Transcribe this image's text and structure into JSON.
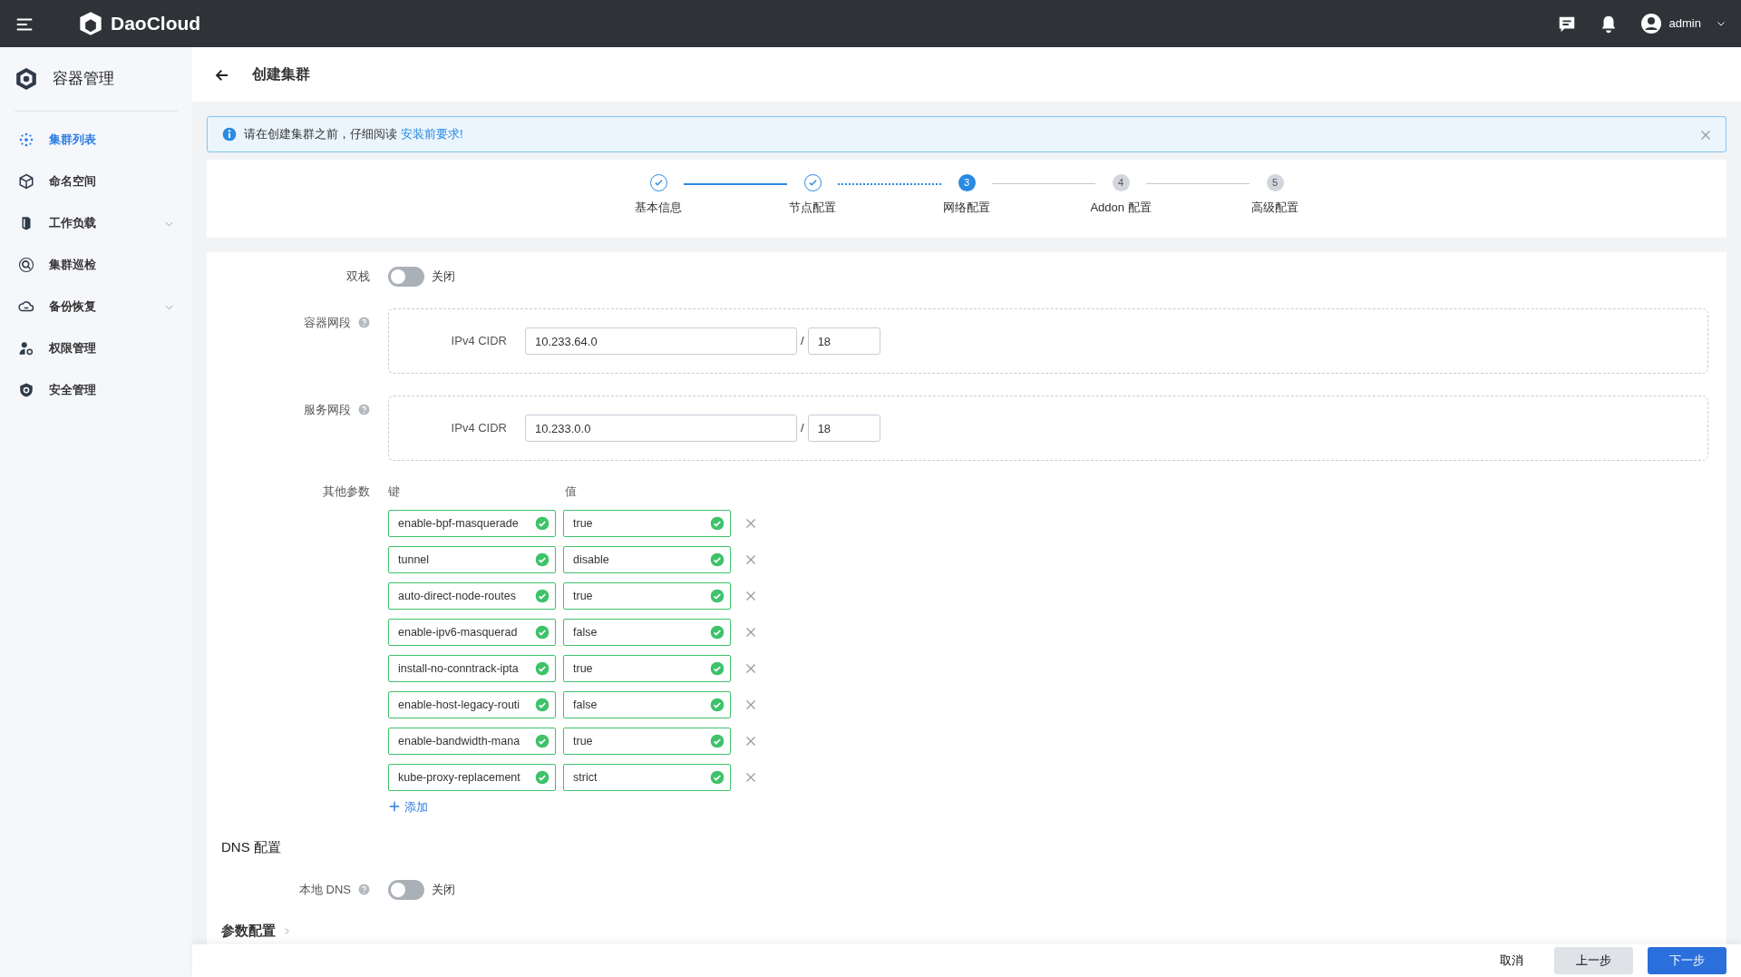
{
  "topbar": {
    "brand": "DaoCloud",
    "user": "admin"
  },
  "sidebar": {
    "title": "容器管理",
    "items": [
      {
        "label": "集群列表",
        "selected": true,
        "expandable": false
      },
      {
        "label": "命名空间",
        "selected": false,
        "expandable": false
      },
      {
        "label": "工作负载",
        "selected": false,
        "expandable": true
      },
      {
        "label": "集群巡检",
        "selected": false,
        "expandable": false
      },
      {
        "label": "备份恢复",
        "selected": false,
        "expandable": true
      },
      {
        "label": "权限管理",
        "selected": false,
        "expandable": false
      },
      {
        "label": "安全管理",
        "selected": false,
        "expandable": false
      }
    ]
  },
  "page": {
    "title": "创建集群"
  },
  "alert": {
    "text": "请在创建集群之前，仔细阅读",
    "link": "安装前要求!"
  },
  "steps": [
    {
      "label": "基本信息",
      "done": true,
      "selected": false
    },
    {
      "label": "节点配置",
      "done": true,
      "selected": false
    },
    {
      "label": "网络配置",
      "number": "3",
      "done": false,
      "selected": true
    },
    {
      "label": "Addon 配置",
      "number": "4",
      "done": false,
      "selected": false
    },
    {
      "label": "高级配置",
      "number": "5",
      "done": false,
      "selected": false
    }
  ],
  "form": {
    "dual_stack": {
      "label": "双栈",
      "on": false,
      "state_text": "关闭"
    },
    "networks": [
      {
        "label": "容器网段",
        "cidr_label": "IPv4 CIDR",
        "address": "10.233.64.0",
        "separator": "/",
        "prefix": "18"
      },
      {
        "label": "服务网段",
        "cidr_label": "IPv4 CIDR",
        "address": "10.233.0.0",
        "separator": "/",
        "prefix": "18"
      }
    ],
    "other_params": {
      "label": "其他参数",
      "key_header": "键",
      "value_header": "值",
      "add": "添加",
      "rows": [
        {
          "key": "enable-bpf-masquerade",
          "value": "true"
        },
        {
          "key": "tunnel",
          "value": "disable"
        },
        {
          "key": "auto-direct-node-routes",
          "value": "true"
        },
        {
          "key": "enable-ipv6-masquerad",
          "value": "false"
        },
        {
          "key": "install-no-conntrack-ipta",
          "value": "true"
        },
        {
          "key": "enable-host-legacy-routi",
          "value": "false"
        },
        {
          "key": "enable-bandwidth-mana",
          "value": "true"
        },
        {
          "key": "kube-proxy-replacement",
          "value": "strict"
        }
      ]
    },
    "dns_section": "DNS 配置",
    "local_dns": {
      "label": "本地 DNS",
      "on": false,
      "state_text": "关闭"
    },
    "params_section": "参数配置"
  },
  "footer": {
    "cancel": "取消",
    "prev": "上一步",
    "next": "下一步"
  }
}
